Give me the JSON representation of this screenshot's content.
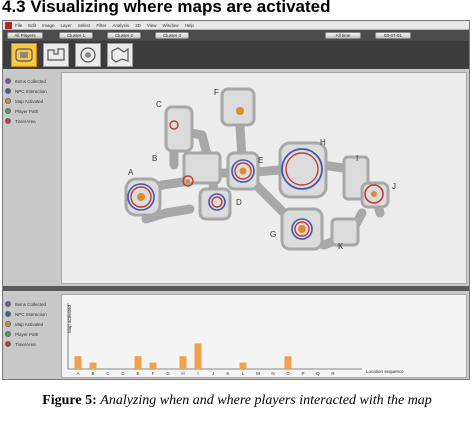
{
  "heading": "4.3 Visualizing where maps are activated",
  "menu": [
    "File",
    "Edit",
    "Image",
    "Layer",
    "Select",
    "Filter",
    "Analysis",
    "3D",
    "View",
    "Window",
    "Help"
  ],
  "toolbar": {
    "players_label": "All Players",
    "clusters": [
      "Cluster 1",
      "Cluster 2",
      "Cluster 3"
    ],
    "time_label": "All time",
    "date_value": "03-07-01"
  },
  "thumbnails": 4,
  "legend": [
    {
      "label": "Items Collected",
      "color": "#7a4ea8"
    },
    {
      "label": "NPC Interaction",
      "color": "#3c57b5"
    },
    {
      "label": "Map Activated",
      "color": "#e08a2e"
    },
    {
      "label": "Player Path",
      "color": "#4aa24a"
    },
    {
      "label": "Time/Area",
      "color": "#c33a32"
    }
  ],
  "map_labels": {
    "A": "A",
    "B": "B",
    "C": "C",
    "D": "D",
    "E": "E",
    "F": "F",
    "G": "G",
    "H": "H",
    "I": "I",
    "J": "J",
    "K": "K"
  },
  "chart_data": {
    "type": "bar",
    "categories": [
      "A",
      "B",
      "C",
      "D",
      "E",
      "F",
      "G",
      "H",
      "I",
      "J",
      "K",
      "L",
      "M",
      "N",
      "O",
      "P",
      "Q",
      "R"
    ],
    "values": [
      2,
      1,
      0,
      0,
      2,
      1,
      0,
      2,
      4,
      0,
      0,
      1,
      0,
      0,
      2,
      0,
      0,
      0
    ],
    "xlabel": "Location sequence",
    "ylabel": "Map activated",
    "color": "#f0a24a"
  },
  "caption": {
    "label": "Figure 5:",
    "text": "Analyzing when and where players interacted with the map"
  }
}
